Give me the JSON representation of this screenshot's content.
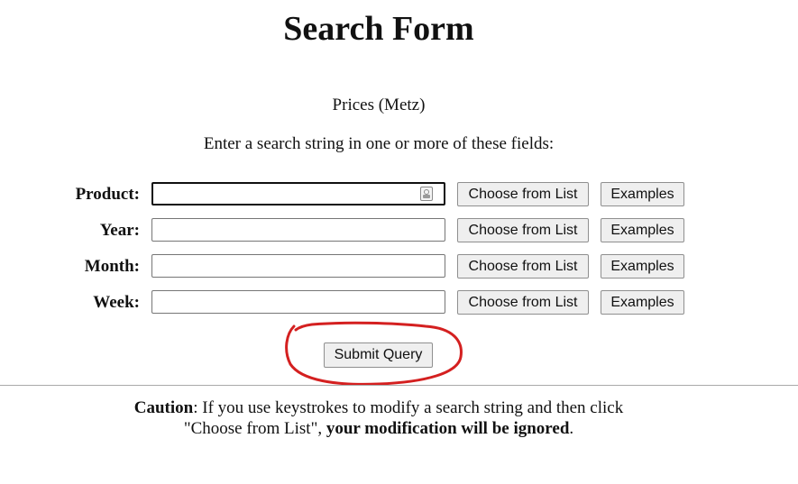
{
  "page": {
    "title": "Search Form",
    "subtitle": "Prices (Metz)",
    "instruction": "Enter a search string in one or more of these fields:"
  },
  "form": {
    "fields": [
      {
        "label": "Product:",
        "value": "",
        "choose_label": "Choose from List",
        "examples_label": "Examples"
      },
      {
        "label": "Year:",
        "value": "",
        "choose_label": "Choose from List",
        "examples_label": "Examples"
      },
      {
        "label": "Month:",
        "value": "",
        "choose_label": "Choose from List",
        "examples_label": "Examples"
      },
      {
        "label": "Week:",
        "value": "",
        "choose_label": "Choose from List",
        "examples_label": "Examples"
      }
    ],
    "submit_label": "Submit Query"
  },
  "caution": {
    "heading": "Caution",
    "text_part1": ": If you use keystrokes to modify a search string and then click",
    "text_part2": "\"Choose from List\", ",
    "bold_part": "your modification will be ignored",
    "end": "."
  },
  "annotation": {
    "highlight_color": "#d42020",
    "icon": "autofill-contact-icon"
  }
}
